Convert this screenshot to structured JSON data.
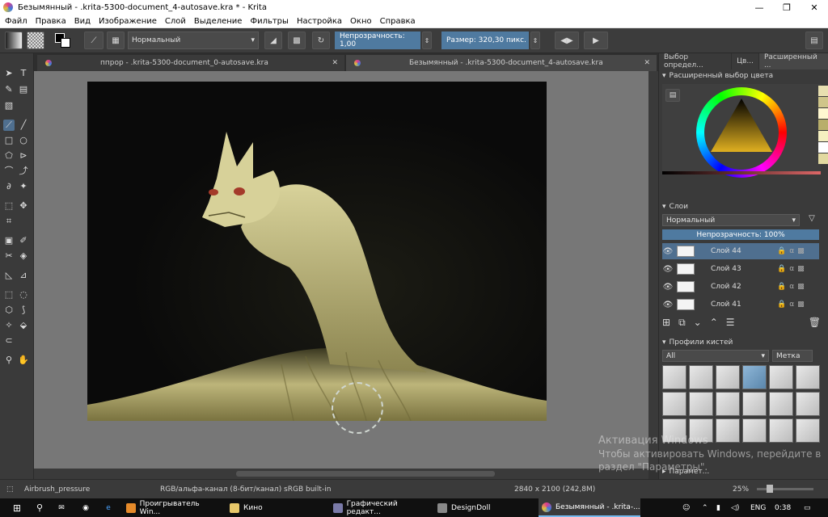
{
  "window": {
    "title": "Безымянный - .krita-5300-document_4-autosave.kra * - Krita",
    "controls": [
      "—",
      "❐",
      "✕"
    ]
  },
  "menu": [
    "Файл",
    "Правка",
    "Вид",
    "Изображение",
    "Слой",
    "Выделение",
    "Фильтры",
    "Настройка",
    "Окно",
    "Справка"
  ],
  "toolbar": {
    "blend_mode": "Нормальный",
    "opacity": "Непрозрачность:  1,00",
    "size": "Размер:  320,30 пикс."
  },
  "tabs": [
    {
      "label": "ппрор - .krita-5300-document_0-autosave.kra"
    },
    {
      "label": "Безымянный - .krita-5300-document_4-autosave.kra"
    }
  ],
  "dock": {
    "tabs": [
      "Выбор определ...",
      "Цв...",
      "Расширенный ..."
    ],
    "color_panel_title": "Расширенный выбор цвета",
    "layers_title": "Слои",
    "layers_blend": "Нормальный",
    "layers_opacity": "Непрозрачность:  100%",
    "layers": [
      {
        "name": "Слой 44",
        "selected": true
      },
      {
        "name": "Слой 43",
        "selected": false
      },
      {
        "name": "Слой 42",
        "selected": false
      },
      {
        "name": "Слой 41",
        "selected": false
      }
    ],
    "brush_presets_title": "Профили кистей",
    "brush_filter": "All",
    "brush_tag": "Метка",
    "params_label": "Парамет..."
  },
  "status": {
    "brush": "Airbrush_pressure",
    "colorspace": "RGB/альфа-канал (8-бит/канал)  sRGB built-in",
    "dimensions": "2840 x 2100 (242,8M)",
    "zoom": "25%"
  },
  "activation": {
    "line1": "Активация Windows",
    "line2": "Чтобы активировать Windows, перейдите в",
    "line3": "раздел \"Параметры\"."
  },
  "taskbar": {
    "items": [
      "Проигрыватель Win...",
      "Кино",
      "Графический редакт...",
      "DesignDoll",
      "Безымянный - .krita-..."
    ],
    "lang": "ENG",
    "time": "0:38"
  }
}
